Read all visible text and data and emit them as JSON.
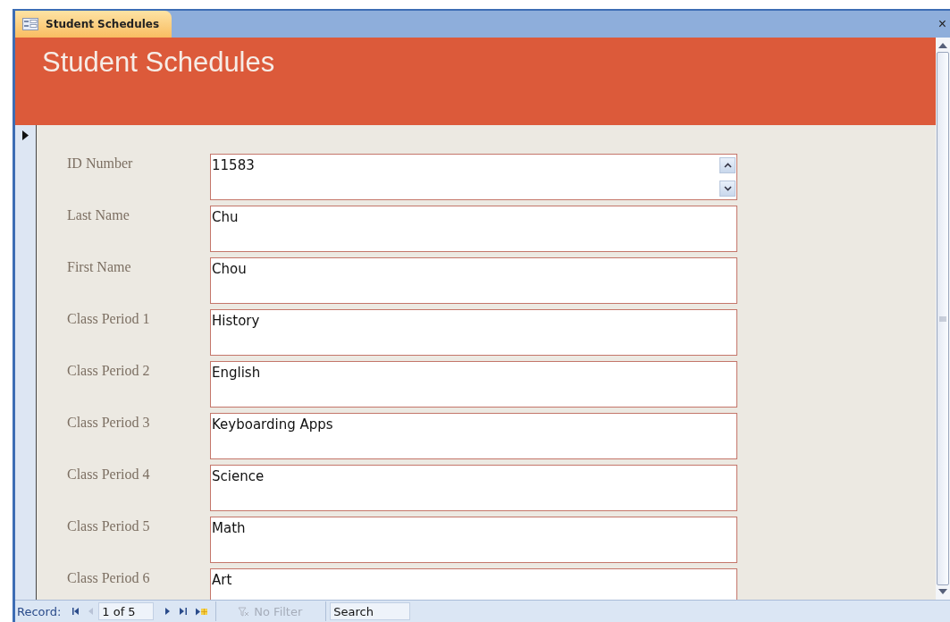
{
  "window": {
    "tab_title": "Student Schedules",
    "close": "×"
  },
  "header": {
    "title": "Student Schedules"
  },
  "fields": [
    {
      "label": "ID Number",
      "value": "11583",
      "kind": "spin"
    },
    {
      "label": "Last Name",
      "value": "Chu",
      "kind": "text"
    },
    {
      "label": "First Name",
      "value": "Chou",
      "kind": "text"
    },
    {
      "label": "Class Period 1",
      "value": "History",
      "kind": "text"
    },
    {
      "label": "Class Period 2",
      "value": "English",
      "kind": "text"
    },
    {
      "label": "Class Period 3",
      "value": "Keyboarding Apps",
      "kind": "text"
    },
    {
      "label": "Class Period 4",
      "value": "Science",
      "kind": "text"
    },
    {
      "label": "Class Period 5",
      "value": "Math",
      "kind": "text"
    },
    {
      "label": "Class Period 6",
      "value": "Art",
      "kind": "text"
    }
  ],
  "status_bar": {
    "record_label": "Record:",
    "record_position": "1 of 5",
    "filter": {
      "label": "No Filter",
      "disabled": true
    },
    "search": {
      "placeholder": "Search"
    }
  }
}
